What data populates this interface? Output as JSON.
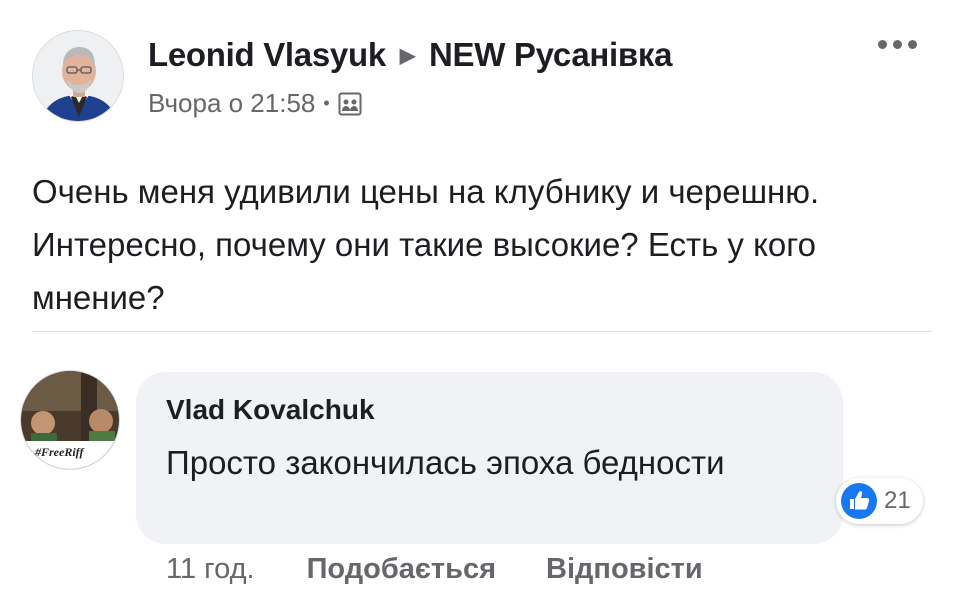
{
  "post": {
    "author": "Leonid Vlasyuk",
    "group": "NEW Русанівка",
    "timestamp": "Вчора о 21:58",
    "privacy_icon": "group-icon",
    "text": "Очень меня удивили цены на клубнику и черешню. Интересно, почему они такие высокие? Есть у кого мнение?"
  },
  "comment": {
    "author": "Vlad Kovalchuk",
    "text": "Просто закончилась эпоха бедности",
    "avatar_text": "#FreeRiff",
    "reactions_count": "21",
    "time": "11 год.",
    "like_label": "Подобається",
    "reply_label": "Відповісти"
  },
  "colors": {
    "text_primary": "#1c1e21",
    "text_secondary": "#65676b",
    "bubble": "#f0f2f5",
    "like_blue": "#1877f2"
  }
}
